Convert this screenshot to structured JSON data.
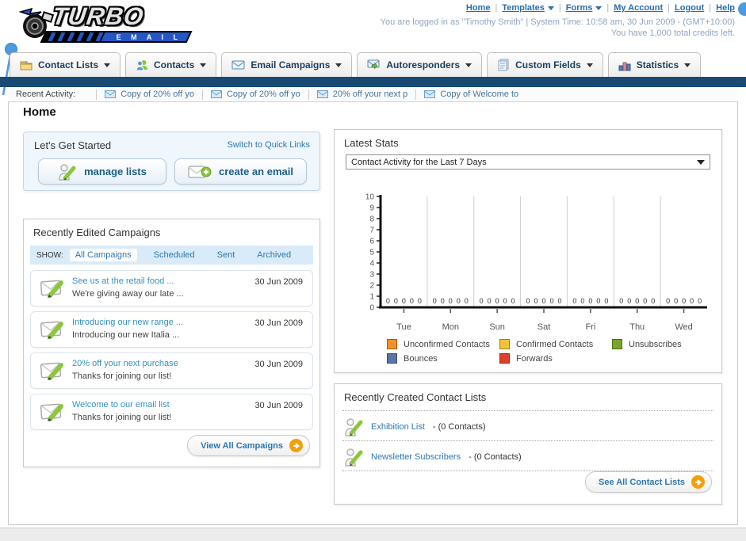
{
  "header": {
    "divider": "|",
    "nav": [
      {
        "label": "Home",
        "dropdown": false
      },
      {
        "label": "Templates",
        "dropdown": true
      },
      {
        "label": "Forms",
        "dropdown": true
      },
      {
        "label": "My Account",
        "dropdown": false
      },
      {
        "label": "Logout",
        "dropdown": false
      },
      {
        "label": "Help",
        "dropdown": false
      }
    ],
    "login_line": "You are logged in as \"Timothy Smith\" | System Time: 10:58 am, 30 Jun 2009 - (GMT+10:00)",
    "credits_line": "You have 1,000 total credits left.",
    "logo_title": "TURBO",
    "logo_subtitle": "E M A I L"
  },
  "tabs": [
    {
      "label": "Contact Lists"
    },
    {
      "label": "Contacts"
    },
    {
      "label": "Email Campaigns"
    },
    {
      "label": "Autoresponders"
    },
    {
      "label": "Custom Fields"
    },
    {
      "label": "Statistics"
    }
  ],
  "recent_activity": {
    "label": "Recent Activity:",
    "items": [
      "Copy of 20% off yo",
      "Copy of 20% off yo",
      "20% off your next p",
      "Copy of Welcome to"
    ]
  },
  "page_title": "Home",
  "get_started": {
    "title": "Let's Get Started",
    "switch_link": "Switch to Quick Links",
    "manage_button": "manage lists",
    "create_button": "create an email"
  },
  "campaigns": {
    "title": "Recently Edited Campaigns",
    "show_label": "SHOW:",
    "filters": [
      "All Campaigns",
      "Scheduled",
      "Sent",
      "Archived"
    ],
    "items": [
      {
        "title": "See us at the retail food ...",
        "subtitle": "We're giving away our late ...",
        "date": "30 Jun 2009"
      },
      {
        "title": "Introducing our new range ...",
        "subtitle": "Introducing our new Italia ...",
        "date": "30 Jun 2009"
      },
      {
        "title": "20% off your next purchase",
        "subtitle": "Thanks for joining our list!",
        "date": "30 Jun 2009"
      },
      {
        "title": "Welcome to our email list",
        "subtitle": "Thanks for joining our list!",
        "date": "30 Jun 2009"
      }
    ],
    "view_all": "View All Campaigns"
  },
  "stats": {
    "title": "Latest Stats",
    "dropdown_value": "Contact Activity for the Last 7 Days"
  },
  "chart_data": {
    "type": "bar",
    "title": "Contact Activity for the Last 7 Days",
    "categories": [
      "Tue",
      "Mon",
      "Sun",
      "Sat",
      "Fri",
      "Thu",
      "Wed"
    ],
    "series": [
      {
        "name": "Unconfirmed Contacts",
        "color": "#f59127",
        "values": [
          0,
          0,
          0,
          0,
          0,
          0,
          0
        ]
      },
      {
        "name": "Confirmed Contacts",
        "color": "#f2c337",
        "values": [
          0,
          0,
          0,
          0,
          0,
          0,
          0
        ]
      },
      {
        "name": "Unsubscribes",
        "color": "#7ba529",
        "values": [
          0,
          0,
          0,
          0,
          0,
          0,
          0
        ]
      },
      {
        "name": "Bounces",
        "color": "#5974a8",
        "values": [
          0,
          0,
          0,
          0,
          0,
          0,
          0
        ]
      },
      {
        "name": "Forwards",
        "color": "#df3f27",
        "values": [
          0,
          0,
          0,
          0,
          0,
          0,
          0
        ]
      }
    ],
    "ylim": [
      0,
      10
    ],
    "yticks": [
      0,
      1,
      2,
      3,
      4,
      5,
      6,
      7,
      8,
      9,
      10
    ],
    "grid": "vertical",
    "legend_position": "bottom"
  },
  "contact_lists": {
    "title": "Recently Created Contact Lists",
    "items": [
      {
        "name": "Exhibition List",
        "count": "- (0 Contacts)"
      },
      {
        "name": "Newsletter Subscribers",
        "count": "- (0 Contacts)"
      }
    ],
    "see_all": "See All Contact Lists"
  }
}
